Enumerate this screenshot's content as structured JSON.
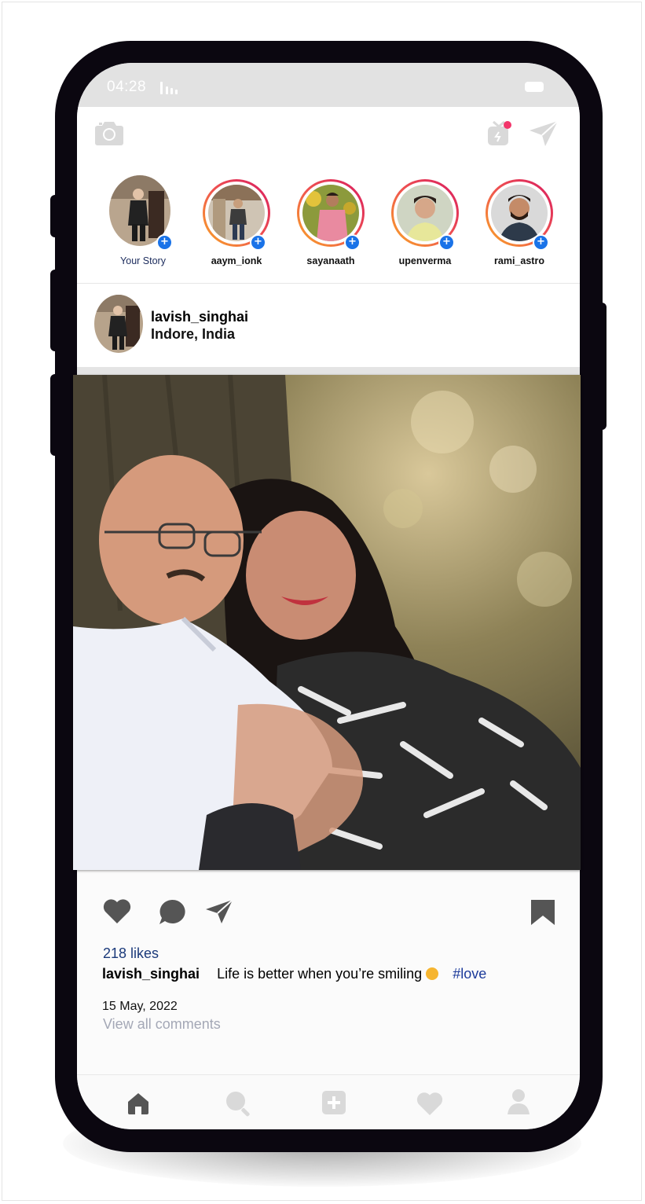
{
  "status": {
    "time": "04:28"
  },
  "stories": [
    {
      "username": "Your Story",
      "own": true
    },
    {
      "username": "aaym_ionk"
    },
    {
      "username": "sayanaath"
    },
    {
      "username": "upenverma"
    },
    {
      "username": "rami_astro"
    }
  ],
  "post": {
    "username": "lavish_singhai",
    "location": "Indore, India",
    "likes": "218 likes",
    "caption_user": "lavish_singhai",
    "caption_text": "Life is better when you’re smiling",
    "hashtag": "#love",
    "date": "15 May, 2022",
    "view_comments": "View all comments"
  },
  "icons": {
    "camera": "camera-icon",
    "igtv": "igtv-icon",
    "direct": "paper-plane-icon",
    "like": "heart-icon",
    "comment": "comment-icon",
    "share": "paper-plane-icon",
    "save": "bookmark-icon",
    "nav": [
      "home-icon",
      "search-icon",
      "add-post-icon",
      "activity-heart-icon",
      "profile-icon"
    ]
  },
  "colors": {
    "phone_frame": "#0b0710",
    "story_ring_gradient": [
      "#f9a825",
      "#ef5350",
      "#d81b60"
    ],
    "story_add_badge": "#1a73e8",
    "likes_text": "#1b3a7a",
    "hashtag": "#1b3a9a",
    "notification_dot": "#f2366b"
  }
}
